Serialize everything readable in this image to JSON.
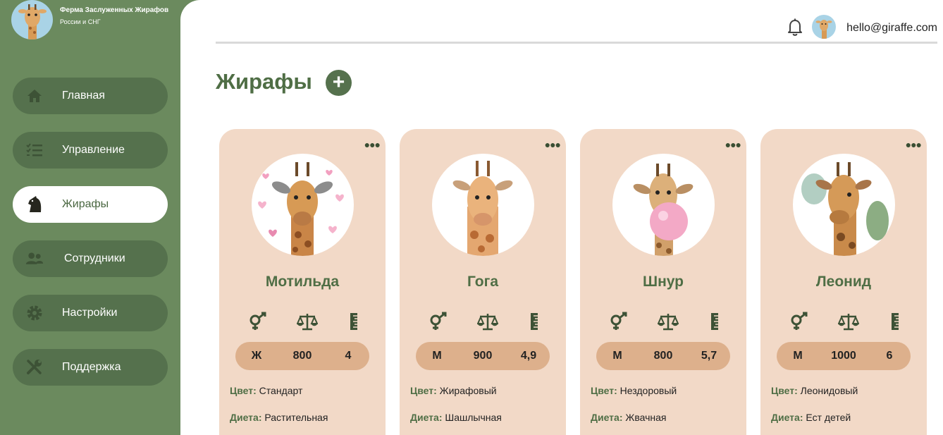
{
  "brand": {
    "title": "Ферма Заслуженных Жирафов",
    "subtitle": "России и СНГ"
  },
  "sidebar": {
    "items": [
      {
        "label": "Главная",
        "icon": "home-icon",
        "active": false
      },
      {
        "label": "Управление",
        "icon": "checklist-icon",
        "active": false
      },
      {
        "label": "Жирафы",
        "icon": "horse-head-icon",
        "active": true
      },
      {
        "label": "Сотрудники",
        "icon": "users-icon",
        "active": false
      },
      {
        "label": "Настройки",
        "icon": "gear-icon",
        "active": false
      },
      {
        "label": "Поддержка",
        "icon": "tools-icon",
        "active": false
      }
    ]
  },
  "header": {
    "email": "hello@giraffe.com"
  },
  "main": {
    "title": "Жирафы",
    "add_label": "+",
    "cards": [
      {
        "name": "Мотильда",
        "sex": "Ж",
        "weight": "800",
        "height": "4",
        "color_label": "Цвет:",
        "color": "Стандарт",
        "diet_label": "Диета:",
        "diet": "Растительная",
        "menu": "●●●"
      },
      {
        "name": "Гога",
        "sex": "М",
        "weight": "900",
        "height": "4,9",
        "color_label": "Цвет:",
        "color": "Жирафовый",
        "diet_label": "Диета:",
        "diet": "Шашлычная",
        "menu": "●●●"
      },
      {
        "name": "Шнур",
        "sex": "М",
        "weight": "800",
        "height": "5,7",
        "color_label": "Цвет:",
        "color": "Нездоровый",
        "diet_label": "Диета:",
        "diet": "Жвачная",
        "menu": "●●●"
      },
      {
        "name": "Леонид",
        "sex": "М",
        "weight": "1000",
        "height": "6",
        "color_label": "Цвет:",
        "color": "Леонидовый",
        "diet_label": "Диета:",
        "diet": "Ест детей",
        "menu": "●●●"
      }
    ]
  },
  "colors": {
    "sidebar": "#6b8a5e",
    "accent": "#4f6e45",
    "card": "#f2d9c7",
    "stats": "#ddb08c"
  }
}
